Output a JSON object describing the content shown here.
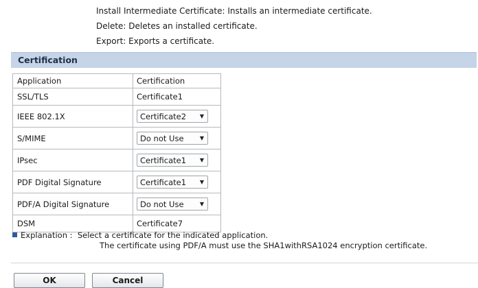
{
  "intro": {
    "lines": [
      "Install Intermediate Certificate: Installs an intermediate certificate.",
      "Delete: Deletes an installed certificate.",
      "Export: Exports a certificate."
    ]
  },
  "section": {
    "title": "Certification"
  },
  "table": {
    "headers": [
      "Application",
      "Certification"
    ],
    "rows": [
      {
        "application": "SSL/TLS",
        "certification": "Certificate1",
        "editable": false
      },
      {
        "application": "IEEE 802.1X",
        "certification": "Certificate2",
        "editable": true
      },
      {
        "application": "S/MIME",
        "certification": "Do not Use",
        "editable": true
      },
      {
        "application": "IPsec",
        "certification": "Certificate1",
        "editable": true
      },
      {
        "application": "PDF Digital Signature",
        "certification": "Certificate1",
        "editable": true
      },
      {
        "application": "PDF/A Digital Signature",
        "certification": "Do not Use",
        "editable": true
      },
      {
        "application": "DSM",
        "certification": "Certificate7",
        "editable": false
      }
    ]
  },
  "explanation": {
    "label": "Explanation :",
    "line1": "Select a certificate for the indicated application.",
    "line2": "The certificate using PDF/A must use the SHA1withRSA1024 encryption certificate."
  },
  "buttons": {
    "ok": "OK",
    "cancel": "Cancel"
  },
  "colors": {
    "section_bg": "#c5d4e6",
    "bullet": "#2d5b9a"
  }
}
